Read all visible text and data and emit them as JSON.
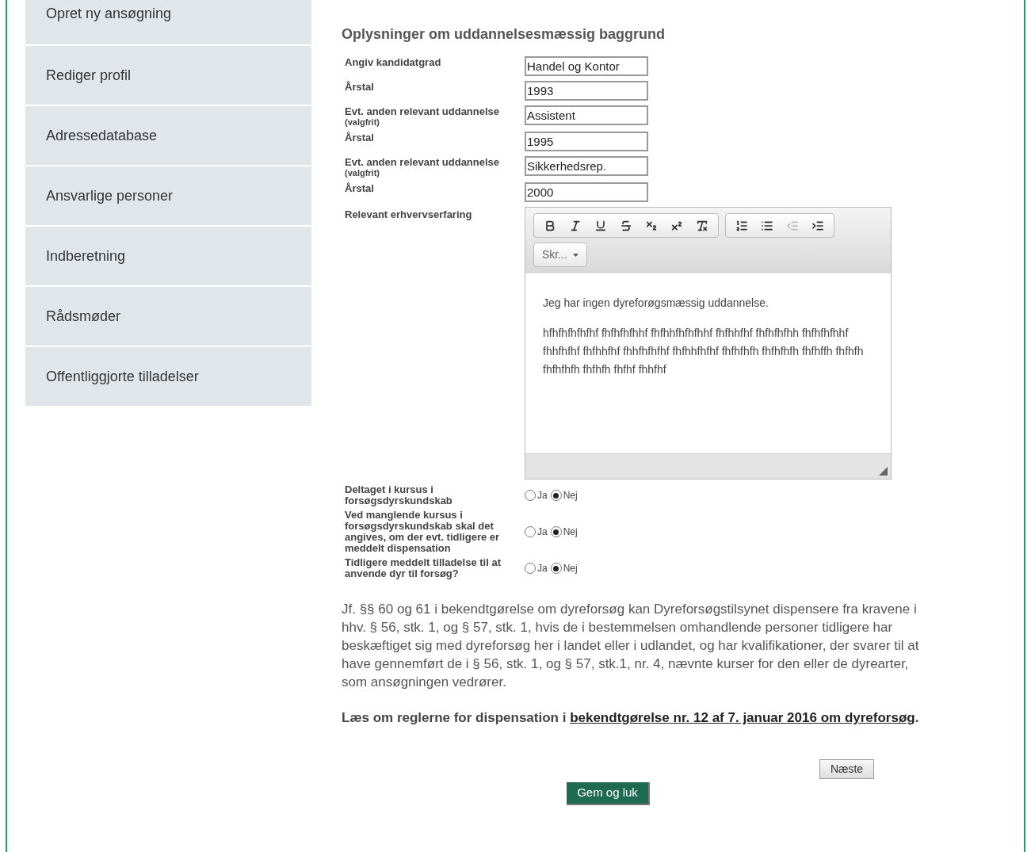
{
  "sidebar": {
    "items": [
      {
        "label": "Opret ny ansøgning",
        "selected": false
      },
      {
        "label": "Rediger profil",
        "selected": false
      },
      {
        "label": "Adressedatabase",
        "selected": false
      },
      {
        "label": "Ansvarlige personer",
        "selected": false
      },
      {
        "label": "Indberetning",
        "selected": false
      },
      {
        "label": "Rådsmøder",
        "selected": false
      },
      {
        "label": "Offentliggjorte tilladelser",
        "selected": false
      }
    ]
  },
  "section_title": "Oplysninger om uddannelsesmæssig baggrund",
  "fields": [
    {
      "label": "Angiv kandidatgrad",
      "value": "Handel og Kontor"
    },
    {
      "label": "Årstal",
      "value": "1993"
    },
    {
      "label": "Evt. anden relevant uddannelse",
      "note": "(valgfrit)",
      "value": "Assistent"
    },
    {
      "label": "Årstal",
      "value": "1995"
    },
    {
      "label": "Evt. anden relevant uddannelse",
      "note": "(valgfrit)",
      "value": "Sikkerhedsrep."
    },
    {
      "label": "Årstal",
      "value": "2000"
    }
  ],
  "editor": {
    "label": "Relevant erhvervserfaring",
    "toolbar_groups": [
      [
        {
          "kind": "bold",
          "disabled": false
        },
        {
          "kind": "italic",
          "disabled": false
        },
        {
          "kind": "underline",
          "disabled": false
        },
        {
          "kind": "strike",
          "disabled": false
        },
        {
          "kind": "subscript",
          "disabled": false
        },
        {
          "kind": "superscript",
          "disabled": false
        },
        {
          "kind": "clear",
          "disabled": false
        }
      ],
      [
        {
          "kind": "ordered",
          "disabled": false
        },
        {
          "kind": "bullets",
          "disabled": false
        },
        {
          "kind": "outdent",
          "disabled": true
        },
        {
          "kind": "indent",
          "disabled": false
        }
      ]
    ],
    "format_dropdown": "Skr...",
    "paragraphs": [
      "Jeg har ingen dyreforøgsmæssig uddannelse.",
      "hfhfhfhfhfhf fhfhfhfhhf fhfhhfhfhfhhf fhfhhfhf fhfhfhfhh fhfhfhfhhf fhhfhfhf fhfhhfhf fhhfhfhfhf fhfhhfhfhf fhfhfhfh fhfhfhfh fhfhffh fhfhfh fhfhfhfh fhfhfh fhfhf fhhfhf"
    ]
  },
  "questions": [
    {
      "label": "Deltaget i kursus i forsøgsdyrskundskab",
      "options": [
        {
          "label": "Ja",
          "selected": false
        },
        {
          "label": "Nej",
          "selected": true
        }
      ]
    },
    {
      "label": "Ved manglende kursus i forsøgsdyrskundskab skal det angives, om der evt. tidligere er meddelt dispensation",
      "options": [
        {
          "label": "Ja",
          "selected": false
        },
        {
          "label": "Nej",
          "selected": true
        }
      ]
    },
    {
      "label": "Tidligere meddelt tilladelse til at anvende dyr til forsøg?",
      "options": [
        {
          "label": "Ja",
          "selected": false
        },
        {
          "label": "Nej",
          "selected": true
        }
      ]
    }
  ],
  "info_text": "Jf. §§ 60 og 61 i bekendtgørelse om dyreforsøg kan Dyreforsøgstilsynet dispensere fra kravene i hhv. § 56, stk. 1, og § 57, stk. 1, hvis de i bestemmelsen omhandlende personer tidligere har beskæftiget sig med dyreforsøg her i landet eller i udlandet, og har kvalifikationer, der svarer til at have gennemført de i § 56, stk. 1, og § 57, stk.1, nr. 4, nævnte kurser for den eller de dyrearter, som ansøgningen vedrører.",
  "rules_note": {
    "text": "Læs om reglerne for dispensation i",
    "link": "bekendtgørelse nr. 12 af 7. januar 2016 om dyreforsøg",
    "end": "."
  },
  "next_button": "Næste",
  "save_button": "Gem og luk"
}
